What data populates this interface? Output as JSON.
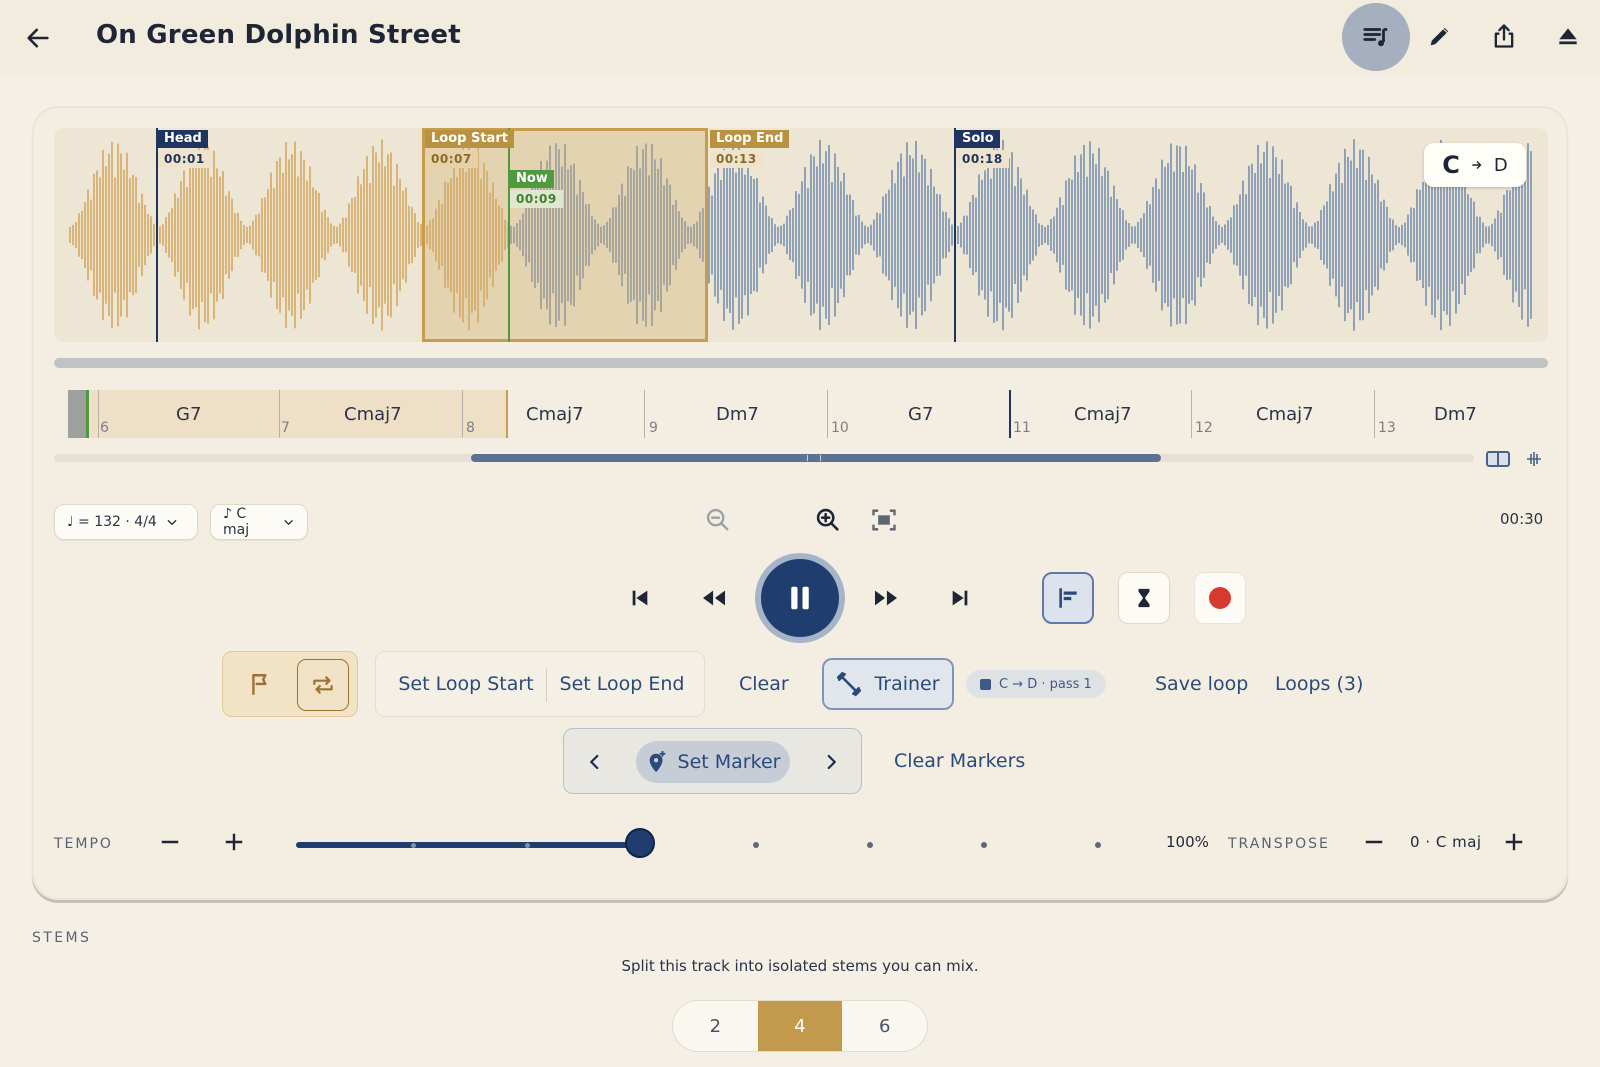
{
  "header": {
    "title": "On Green Dolphin Street"
  },
  "waveform": {
    "markers": [
      {
        "label": "Head",
        "time": "00:01"
      },
      {
        "label": "Loop Start",
        "time": "00:07"
      },
      {
        "label": "Now",
        "time": "00:09"
      },
      {
        "label": "Loop End",
        "time": "00:13"
      },
      {
        "label": "Solo",
        "time": "00:18"
      }
    ],
    "key_change": {
      "from": "C",
      "to": "D"
    }
  },
  "chords": {
    "items": [
      "G7",
      "Cmaj7",
      "Cmaj7",
      "Dm7",
      "G7",
      "Cmaj7",
      "Cmaj7",
      "Dm7"
    ],
    "bars": [
      "6",
      "7",
      "8",
      "9",
      "10",
      "11",
      "12",
      "13"
    ]
  },
  "controls": {
    "tempo_select": "♩ = 132 · 4/4",
    "key_select": "♪ C maj",
    "total_time": "00:30"
  },
  "loop": {
    "set_start": "Set Loop Start",
    "set_end": "Set Loop End",
    "clear": "Clear",
    "trainer": "Trainer",
    "pass_chip": "C → D · pass 1",
    "save": "Save loop",
    "loops": "Loops (3)"
  },
  "markers": {
    "set": "Set Marker",
    "clear": "Clear Markers"
  },
  "tempo": {
    "label": "TEMPO",
    "percent": "100%",
    "value_fraction": 0.43
  },
  "transpose": {
    "label": "TRANSPOSE",
    "value": "0 · C maj"
  },
  "stems": {
    "heading": "STEMS",
    "description": "Split this track into isolated stems you can mix.",
    "options": [
      "2",
      "4",
      "6"
    ],
    "selected": "4"
  },
  "colors": {
    "played": "#d2a862",
    "unplayed": "#7890b0",
    "accent": "#1f3e6f",
    "loop": "#c69d4e",
    "now": "#4f9a3c",
    "record": "#d63a2f"
  }
}
